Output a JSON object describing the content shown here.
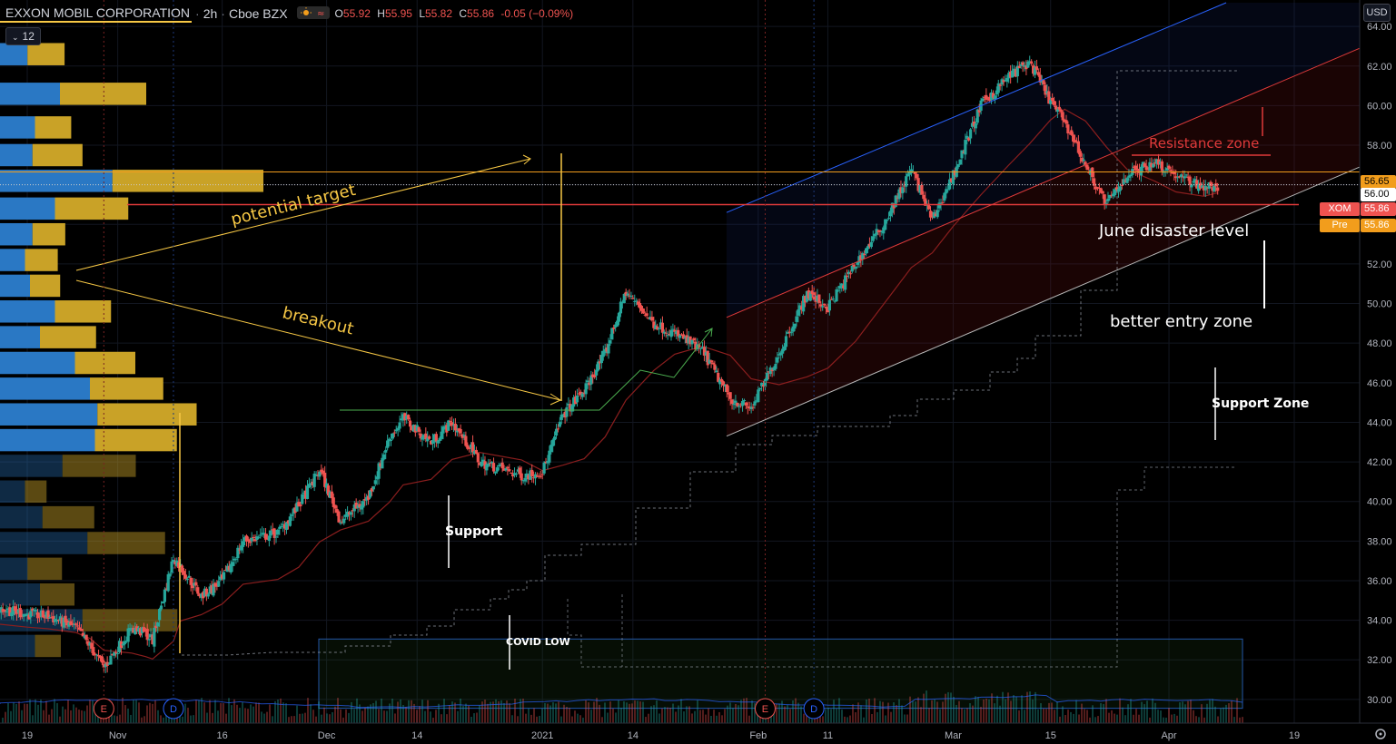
{
  "header": {
    "symbol": "EXXON MOBIL CORPORATION",
    "interval": "2h",
    "exchange": "Cboe BZX",
    "open_label": "O",
    "open": "55.92",
    "high_label": "H",
    "high": "55.95",
    "low_label": "L",
    "low": "55.82",
    "close_label": "C",
    "close": "55.86",
    "change": "-0.05 (−0.09%)"
  },
  "volume_length": "12",
  "currency_badge": "USD",
  "colors": {
    "up": "#26a69a",
    "down": "#ef5350",
    "annotation_yellow": "#f7c845",
    "resistance_red": "#e03a3a",
    "white_annotation": "#ffffff",
    "channel_blue": "#2962ff",
    "green_marker": "#4caf50",
    "vp_blue": "#2a78c4",
    "vp_gold": "#c9a227"
  },
  "price_tags": [
    {
      "label": "",
      "value": "56.65",
      "bg": "#f29d1c",
      "fg": "#000000"
    },
    {
      "label": "",
      "value": "56.00",
      "bg": "#ffffff",
      "fg": "#000000"
    },
    {
      "label": "XOM",
      "value": "55.86",
      "bg": "#ef5350",
      "fg": "#ffffff"
    },
    {
      "label": "Pre",
      "value": "55.86",
      "bg": "#f29d1c",
      "fg": "#ffffff"
    }
  ],
  "events": [
    {
      "type": "earnings",
      "label": "E",
      "date": "2020-10-30"
    },
    {
      "type": "dividend",
      "label": "D",
      "date": "2020-11-09"
    },
    {
      "type": "earnings",
      "label": "E",
      "date": "2021-02-02"
    },
    {
      "type": "dividend",
      "label": "D",
      "date": "2021-02-09"
    }
  ],
  "annotations": {
    "potential_target": "potential target",
    "breakout": "breakout",
    "resistance_zone": "Resistance zone",
    "june_disaster": "June disaster level",
    "better_entry": "better entry zone",
    "support_zone": "Support Zone",
    "support": "Support",
    "covid_low": "COVID LOW"
  },
  "chart_data": {
    "type": "candlestick",
    "title": "EXXON MOBIL CORPORATION · 2h · Cboe BZX",
    "x_tick_labels": [
      "19",
      "Nov",
      "16",
      "Dec",
      "14",
      "2021",
      "14",
      "Feb",
      "11",
      "Mar",
      "15",
      "Apr",
      "19"
    ],
    "x_tick_dates": [
      "2020-10-19",
      "2020-11-01",
      "2020-11-16",
      "2020-12-01",
      "2020-12-14",
      "2021-01-01",
      "2021-01-14",
      "2021-02-01",
      "2021-02-11",
      "2021-03-01",
      "2021-03-15",
      "2021-04-01",
      "2021-04-19"
    ],
    "x_range": [
      "2020-10-15",
      "2021-04-27"
    ],
    "ylim": [
      28.8,
      65.2
    ],
    "y_ticks": [
      30.0,
      32.0,
      34.0,
      36.0,
      38.0,
      40.0,
      42.0,
      44.0,
      46.0,
      48.0,
      50.0,
      52.0,
      54.0,
      56.0,
      58.0,
      60.0,
      62.0,
      64.0
    ],
    "price_path": [
      [
        "2020-10-15",
        34.6
      ],
      [
        "2020-10-19",
        34.3
      ],
      [
        "2020-10-22",
        34.2
      ],
      [
        "2020-10-26",
        33.6
      ],
      [
        "2020-10-28",
        32.7
      ],
      [
        "2020-10-30",
        31.6
      ],
      [
        "2020-11-03",
        33.6
      ],
      [
        "2020-11-05",
        33.3
      ],
      [
        "2020-11-06",
        33.0
      ],
      [
        "2020-11-09",
        37.2
      ],
      [
        "2020-11-10",
        36.7
      ],
      [
        "2020-11-13",
        35.2
      ],
      [
        "2020-11-16",
        36.0
      ],
      [
        "2020-11-19",
        38.0
      ],
      [
        "2020-11-24",
        38.4
      ],
      [
        "2020-11-27",
        39.8
      ],
      [
        "2020-11-30",
        41.6
      ],
      [
        "2020-12-03",
        39.0
      ],
      [
        "2020-12-07",
        40.2
      ],
      [
        "2020-12-10",
        43.2
      ],
      [
        "2020-12-12",
        44.2
      ],
      [
        "2020-12-16",
        43.0
      ],
      [
        "2020-12-19",
        44.0
      ],
      [
        "2020-12-23",
        42.0
      ],
      [
        "2020-12-29",
        41.3
      ],
      [
        "2021-01-01",
        41.5
      ],
      [
        "2021-01-04",
        44.4
      ],
      [
        "2021-01-07",
        45.6
      ],
      [
        "2021-01-10",
        47.5
      ],
      [
        "2021-01-13",
        50.6
      ],
      [
        "2021-01-17",
        49.0
      ],
      [
        "2021-01-20",
        48.5
      ],
      [
        "2021-01-24",
        47.6
      ],
      [
        "2021-01-28",
        45.2
      ],
      [
        "2021-01-31",
        44.7
      ],
      [
        "2021-02-04",
        47.5
      ],
      [
        "2021-02-08",
        50.5
      ],
      [
        "2021-02-11",
        49.8
      ],
      [
        "2021-02-15",
        52.0
      ],
      [
        "2021-02-19",
        54.0
      ],
      [
        "2021-02-23",
        56.8
      ],
      [
        "2021-02-26",
        54.2
      ],
      [
        "2021-03-01",
        56.5
      ],
      [
        "2021-03-05",
        60.0
      ],
      [
        "2021-03-09",
        61.5
      ],
      [
        "2021-03-12",
        62.2
      ],
      [
        "2021-03-15",
        60.2
      ],
      [
        "2021-03-17",
        59.2
      ],
      [
        "2021-03-20",
        57.0
      ],
      [
        "2021-03-23",
        55.0
      ],
      [
        "2021-03-26",
        56.5
      ],
      [
        "2021-03-30",
        57.2
      ],
      [
        "2021-04-02",
        56.5
      ],
      [
        "2021-04-06",
        55.9
      ],
      [
        "2021-04-08",
        55.86
      ]
    ],
    "lines": {
      "orange_level_56_65": 56.65,
      "white_dotted_56_00": 56.0,
      "red_june_level": 55.0
    },
    "volume_profile": [
      {
        "price": 62.6,
        "a": 55,
        "b": 43
      },
      {
        "price": 60.6,
        "a": 120,
        "b": 100
      },
      {
        "price": 58.9,
        "a": 70,
        "b": 42
      },
      {
        "price": 57.5,
        "a": 65,
        "b": 58
      },
      {
        "price": 56.2,
        "a": 225,
        "b": 175
      },
      {
        "price": 54.8,
        "a": 110,
        "b": 85
      },
      {
        "price": 53.5,
        "a": 65,
        "b": 38
      },
      {
        "price": 52.2,
        "a": 50,
        "b": 38
      },
      {
        "price": 50.9,
        "a": 60,
        "b": 35
      },
      {
        "price": 49.6,
        "a": 110,
        "b": 65
      },
      {
        "price": 48.3,
        "a": 80,
        "b": 65
      },
      {
        "price": 47.0,
        "a": 150,
        "b": 70
      },
      {
        "price": 45.7,
        "a": 180,
        "b": 85
      },
      {
        "price": 44.4,
        "a": 195,
        "b": 115
      },
      {
        "price": 43.1,
        "a": 190,
        "b": 95
      },
      {
        "price": 41.8,
        "a": 125,
        "b": 85
      },
      {
        "price": 40.5,
        "a": 50,
        "b": 25
      },
      {
        "price": 39.2,
        "a": 85,
        "b": 60
      },
      {
        "price": 37.9,
        "a": 175,
        "b": 90
      },
      {
        "price": 36.6,
        "a": 55,
        "b": 40
      },
      {
        "price": 35.3,
        "a": 80,
        "b": 40
      },
      {
        "price": 34.0,
        "a": 165,
        "b": 110
      },
      {
        "price": 32.7,
        "a": 70,
        "b": 30
      }
    ]
  }
}
